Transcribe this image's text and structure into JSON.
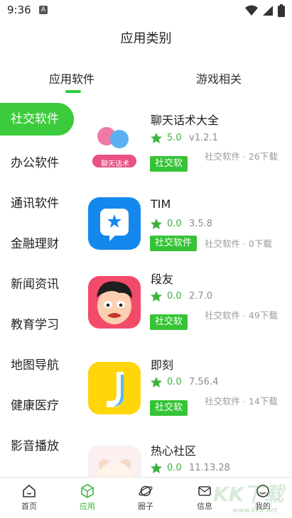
{
  "status_bar": {
    "time": "9:36",
    "app_icon_glyph": "A"
  },
  "header": {
    "title": "应用类别"
  },
  "tabs": [
    {
      "label": "应用软件",
      "active": true
    },
    {
      "label": "游戏相关",
      "active": false
    }
  ],
  "sidebar": {
    "items": [
      {
        "label": "社交软件",
        "active": true
      },
      {
        "label": "办公软件"
      },
      {
        "label": "通讯软件"
      },
      {
        "label": "金融理财"
      },
      {
        "label": "新闻资讯"
      },
      {
        "label": "教育学习"
      },
      {
        "label": "地图导航"
      },
      {
        "label": "健康医疗"
      },
      {
        "label": "影音播放"
      }
    ]
  },
  "apps": [
    {
      "name": "聊天话术大全",
      "rating": "5.0",
      "version": "v1.2.1",
      "tag": "社交软",
      "meta": "社交软件 · 26下载",
      "icon": "hearts-chat-icon",
      "icon_text": "聊天话术"
    },
    {
      "name": "TIM",
      "rating": "0.0",
      "version": "3.5.8",
      "tag": "社交软件",
      "meta": "社交软件 · 0下载",
      "icon": "tim-star-icon"
    },
    {
      "name": "段友",
      "rating": "0.0",
      "version": "2.7.0",
      "tag": "社交软",
      "meta": "社交软件 · 49下载",
      "icon": "cartoon-face-icon"
    },
    {
      "name": "即刻",
      "rating": "0.0",
      "version": "7.56.4",
      "tag": "社交软",
      "meta": "社交软件 · 14下载",
      "icon": "jike-j-icon"
    },
    {
      "name": "热心社区",
      "rating": "0.0",
      "version": "11.13.28",
      "icon": "bear-icon"
    }
  ],
  "bottom_nav": [
    {
      "label": "首页",
      "icon": "home-icon"
    },
    {
      "label": "应用",
      "icon": "cube-icon",
      "active": true
    },
    {
      "label": "圈子",
      "icon": "planet-icon"
    },
    {
      "label": "信息",
      "icon": "mail-icon"
    },
    {
      "label": "我的",
      "icon": "user-icon"
    }
  ],
  "watermark": {
    "text": "KK下载",
    "url": "www.kkx.net"
  },
  "colors": {
    "accent": "#3ccb3c",
    "rating": "#3cb33c",
    "muted": "#9a9a9a"
  }
}
